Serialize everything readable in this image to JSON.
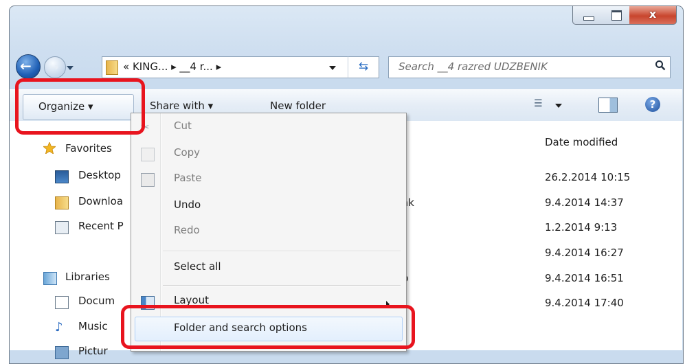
{
  "window": {
    "close_glyph": "x"
  },
  "nav": {
    "address_path": "« KING... ▸ __4 r... ▸",
    "search_placeholder": "Search __4 razred UDZBENIK"
  },
  "toolbar": {
    "organize_label": "Organize ▾",
    "share_label": "Share with ▾",
    "new_folder_label": "New folder"
  },
  "sidebar": {
    "favorites": "Favorites",
    "desktop": "Desktop",
    "downloads": "Downloa",
    "recent": "Recent P",
    "libraries": "Libraries",
    "documents": "Docum",
    "music": "Music",
    "pictures": "Pictur"
  },
  "file_list": {
    "date_header": "Date modified",
    "name_fragments": [
      "ak",
      "b"
    ],
    "dates": [
      "26.2.2014 10:15",
      "9.4.2014 14:37",
      "1.2.2014 9:13",
      "9.4.2014 16:27",
      "9.4.2014 16:51",
      "9.4.2014 17:40"
    ]
  },
  "menu": {
    "cut": "Cut",
    "copy": "Copy",
    "paste": "Paste",
    "undo": "Undo",
    "redo": "Redo",
    "select_all": "Select all",
    "layout": "Layout",
    "folder_options": "Folder and search options"
  },
  "colors": {
    "annotation_red": "#e8141e",
    "menu_highlight": "#e3effd"
  }
}
